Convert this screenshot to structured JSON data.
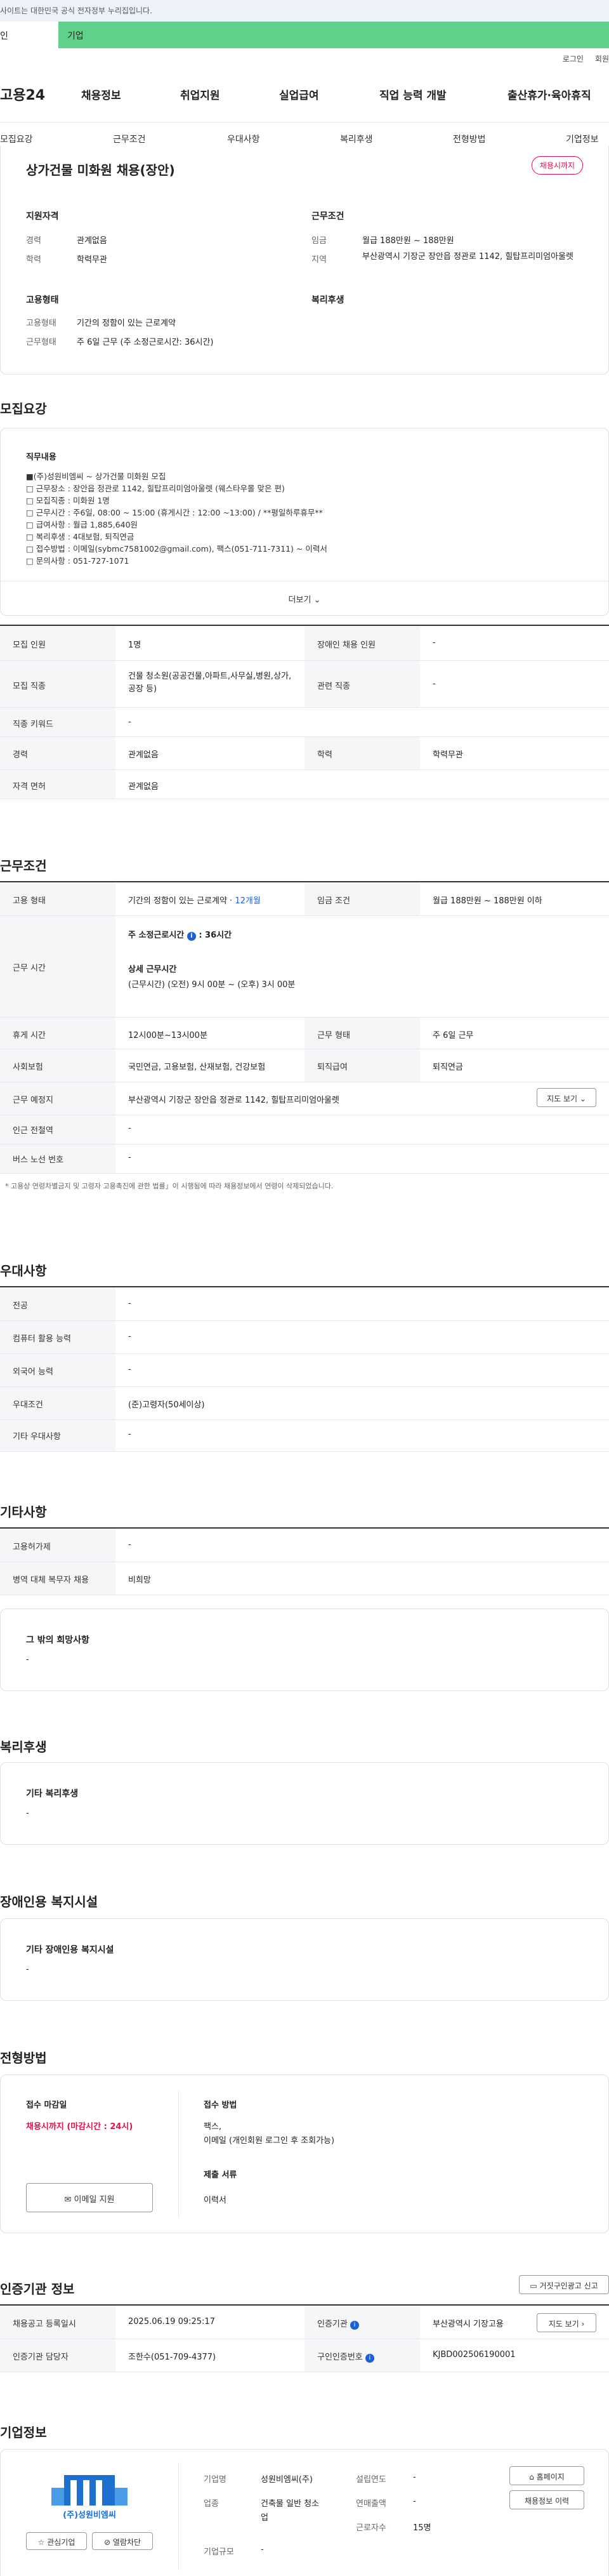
{
  "topbar": {
    "notice": "사이트는 대한민국 공식 전자정부 누리집입니다."
  },
  "mint": {
    "left": "인",
    "right": "기업"
  },
  "util": {
    "login": "로그인",
    "join": "회원"
  },
  "gnb": {
    "logo": "고용24",
    "menu": [
      "채용정보",
      "취업지원",
      "실업급여",
      "직업 능력 개발",
      "출산휴가·육아휴직"
    ]
  },
  "subnav": [
    "모집요강",
    "근무조건",
    "우대사항",
    "복리후생",
    "전형방법",
    "기업정보"
  ],
  "header": {
    "title": "상가건물 미화원 채용(장안)",
    "badge": "채용시까지"
  },
  "summary": {
    "qual_title": "지원자격",
    "qual": [
      {
        "k": "경력",
        "v": "관계없음"
      },
      {
        "k": "학력",
        "v": "학력무관"
      }
    ],
    "cond_title": "근무조건",
    "cond": [
      {
        "k": "임금",
        "v": "월급 188만원 ~ 188만원"
      },
      {
        "k": "지역",
        "v": "부산광역시 기장군 장안읍 정관로 1142, 힐탑프리미엄아울렛"
      }
    ],
    "emp_title": "고용형태",
    "emp": [
      {
        "k": "고용형태",
        "v": "기간의 정함이 있는 근로계약"
      },
      {
        "k": "근무형태",
        "v": "주 6일 근무 (주 소정근로시간: 36시간)"
      }
    ],
    "welfare_title": "복리후생"
  },
  "recruit": {
    "title": "모집요강",
    "job_title": "직무내용",
    "lines": [
      "■(주)성원비엠씨 ~ 상가건물 미화원 모집",
      "□ 근무장소 : 장안읍 정관로 1142, 힐탑프리미엄아울렛 (웨스타우몰 맞은 편)",
      "□ 모집직종 : 미화원 1명",
      "□ 근무시간 : 주6일, 08:00 ~ 15:00 (휴게시간 : 12:00 ~13:00) / **평일하루휴무**",
      "□ 급여사항 : 월급 1,885,640원",
      "□ 복리후생 : 4대보험, 퇴직연금",
      "□ 접수방법 : 이메일(sybmc7581002@gmail.com), 팩스(051-711-7311) ~ 이력서",
      "□ 문의사항 : 051-727-1071"
    ],
    "more": "더보기",
    "table": {
      "headcount_k": "모집 인원",
      "headcount_v": "1명",
      "disabled_k": "장애인 채용 인원",
      "disabled_v": "-",
      "job_k": "모집 직종",
      "job_v": "건물 청소원(공공건물,아파트,사무실,병원,상가,공장 등)",
      "related_k": "관련 직종",
      "related_v": "-",
      "kw_k": "직종 키워드",
      "kw_v": "-",
      "career_k": "경력",
      "career_v": "관계없음",
      "edu_k": "학력",
      "edu_v": "학력무관",
      "license_k": "자격 면허",
      "license_v": "관계없음"
    }
  },
  "work": {
    "title": "근무조건",
    "emp_k": "고용 형태",
    "emp_v": "기간의 정함이 있는 근로계약 · ",
    "emp_months": "12개월",
    "wage_k": "임금 조건",
    "wage_v": "월급 188만원 ~ 188만원 이하",
    "hours_k": "근무 시간",
    "weekly_label": "주 소정근로시간",
    "weekly_v": ": 36시간",
    "detail_label": "상세 근무시간",
    "detail_v": "(근무시간) (오전) 9시 00분 ~ (오후) 3시 00분",
    "break_k": "휴게 시간",
    "break_v": "12시00분~13시00분",
    "type_k": "근무 형태",
    "type_v": "주 6일 근무",
    "ins_k": "사회보험",
    "ins_v": "국민연금, 고용보험, 산재보험, 건강보험",
    "ret_k": "퇴직급여",
    "ret_v": "퇴직연금",
    "place_k": "근무 예정지",
    "place_v": "부산광역시 기장군 장안읍 정관로 1142, 힐탑프리미엄아울렛",
    "map": "지도 보기",
    "subway_k": "인근 전철역",
    "subway_v": "-",
    "bus_k": "버스 노선 번호",
    "bus_v": "-",
    "footnote": "* 고용상 연령차별금지 및 고령자 고용촉진에 관한 법률」이 시행됨에 따라 채용정보에서 연령이 삭제되었습니다."
  },
  "pref": {
    "title": "우대사항",
    "rows": [
      {
        "k": "전공",
        "v": "-"
      },
      {
        "k": "컴퓨터 활용 능력",
        "v": "-"
      },
      {
        "k": "외국어 능력",
        "v": "-"
      },
      {
        "k": "우대조건",
        "v": "(준)고령자(50세이상)"
      },
      {
        "k": "기타 우대사항",
        "v": "-"
      }
    ]
  },
  "etc": {
    "title": "기타사항",
    "rows": [
      {
        "k": "고용허가제",
        "v": "-"
      },
      {
        "k": "병역 대체 복무자 채용",
        "v": "비희망"
      }
    ],
    "other_title": "그 밖의 희망사항",
    "other_v": "-"
  },
  "welfare": {
    "title": "복리후생",
    "box_title": "기타 복리후생",
    "box_v": "-"
  },
  "disability": {
    "title": "장애인용 복지시설",
    "box_title": "기타 장애인용 복지시설",
    "box_v": "-"
  },
  "apply": {
    "title": "전형방법",
    "deadline_title": "접수 마감일",
    "deadline_v": "채용시까지 (마감시간 : 24시)",
    "email_btn": "이메일 지원",
    "method_title": "접수 방법",
    "method_v1": "팩스,",
    "method_v2": "이메일 (개인회원 로그인 후 조회가능)",
    "docs_title": "제출 서류",
    "docs_v": "이력서"
  },
  "cert": {
    "title": "인증기관 정보",
    "report_btn": "거짓구인광고 신고",
    "reg_k": "채용공고 등록일시",
    "reg_v": "2025.06.19 09:25:17",
    "org_k": "인증기관",
    "org_v": "부산광역시 기장고용",
    "map": "지도 보기",
    "mgr_k": "인증기관 담당자",
    "mgr_v": "조한수(051-709-4377)",
    "no_k": "구인인증번호",
    "no_v": "KJBD002506190001"
  },
  "company": {
    "title": "기업정보",
    "logo_text": "(주)성원비엠씨",
    "fav": "관심기업",
    "block": "열람차단",
    "name_k": "기업명",
    "name_v": "성원비엠씨(주)",
    "year_k": "설립연도",
    "year_v": "-",
    "ind_k": "업종",
    "ind_v1": "건축물 일반 청소",
    "ind_v2": "업",
    "sales_k": "연매출액",
    "sales_v": "-",
    "size_k": "기업규모",
    "size_v": "-",
    "emp_k": "근로자수",
    "emp_v": "15명",
    "home_btn": "홈페이지",
    "info_btn": "채용정보 이력"
  }
}
